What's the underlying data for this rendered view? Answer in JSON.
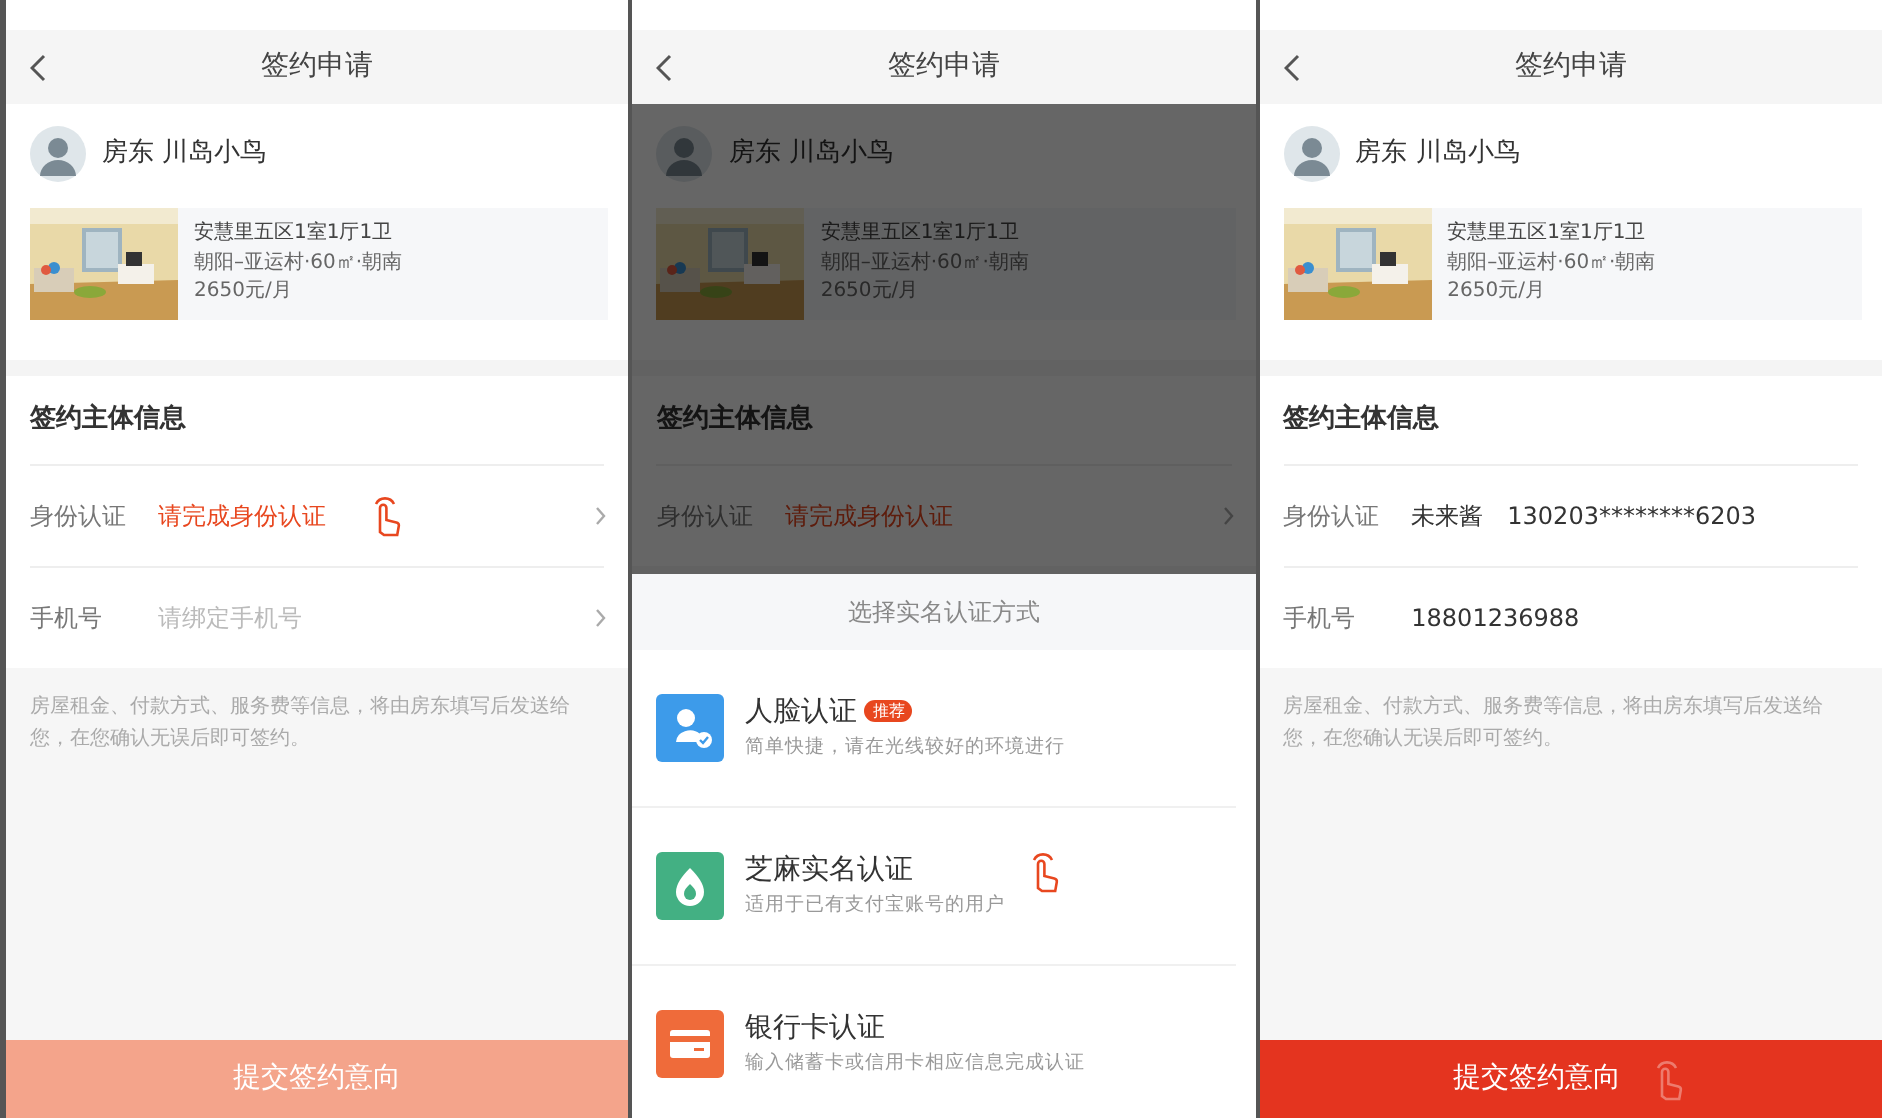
{
  "screens": [
    {
      "title": "签约申请",
      "landlord": "房东 川岛小鸟",
      "listing": {
        "name": "安慧里五区1室1厅1卫",
        "details": "朝阳–亚运村·60㎡·朝南",
        "price": "2650元/月"
      },
      "section_title": "签约主体信息",
      "rows": [
        {
          "kind": "prompt",
          "label": "身份认证",
          "value": "请完成身份认证",
          "chevron": true,
          "touch_hint": true
        },
        {
          "kind": "field",
          "label": "手机号",
          "placeholder": "请绑定手机号",
          "chevron": true
        }
      ],
      "note": "房屋租金、付款方式、服务费等信息，将由房东填写后发送给您，在您确认无误后即可签约。",
      "submit": {
        "label": "提交签约意向",
        "disabled": true
      }
    },
    {
      "title": "签约申请",
      "dimmed": true,
      "landlord": "房东 川岛小鸟",
      "listing": {
        "name": "安慧里五区1室1厅1卫",
        "details": "朝阳–亚运村·60㎡·朝南",
        "price": "2650元/月"
      },
      "section_title": "签约主体信息",
      "rows": [
        {
          "kind": "prompt",
          "label": "身份认证",
          "value": "请完成身份认证",
          "chevron": true
        }
      ],
      "sheet": {
        "title": "选择实名认证方式",
        "options": [
          {
            "kind": "face",
            "title": "人脸认证",
            "badge": "推荐",
            "subtitle": "简单快捷，请在光线较好的环境进行"
          },
          {
            "kind": "zhima",
            "title": "芝麻实名认证",
            "subtitle": "适用于已有支付宝账号的用户",
            "touch_hint": true
          },
          {
            "kind": "bank",
            "title": "银行卡认证",
            "subtitle": "输入储蓄卡或信用卡相应信息完成认证"
          }
        ]
      }
    },
    {
      "title": "签约申请",
      "landlord": "房东 川岛小鸟",
      "listing": {
        "name": "安慧里五区1室1厅1卫",
        "details": "朝阳–亚运村·60㎡·朝南",
        "price": "2650元/月"
      },
      "section_title": "签约主体信息",
      "rows": [
        {
          "kind": "value",
          "label": "身份认证",
          "value": "未来酱",
          "id_number": "130203********6203"
        },
        {
          "kind": "value",
          "label": "手机号",
          "value": "18801236988"
        }
      ],
      "note": "房屋租金、付款方式、服务费等信息，将由房东填写后发送给您，在您确认无误后即可签约。",
      "submit": {
        "label": "提交签约意向",
        "disabled": false,
        "touch_hint": true
      }
    }
  ]
}
